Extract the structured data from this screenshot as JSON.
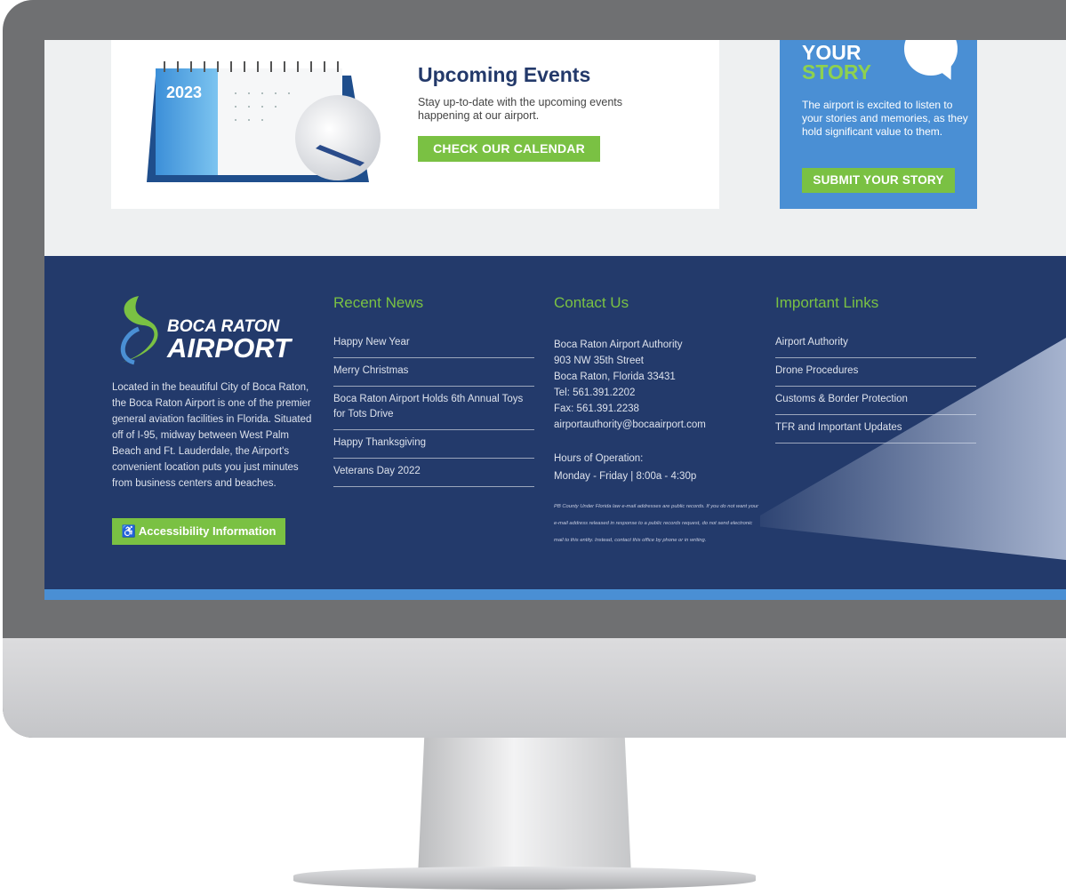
{
  "events": {
    "title": "Upcoming Events",
    "description": "Stay up-to-date with the upcoming events happening at our airport.",
    "button": "CHECK OUR CALENDAR",
    "calendar_year": "2023"
  },
  "story": {
    "title_line1": "YOUR",
    "title_line2": "STORY",
    "description": "The airport is excited to listen to your stories and memories, as they hold significant value to them.",
    "button": "SUBMIT YOUR STORY"
  },
  "footer": {
    "logo_line1": "BOCA RATON",
    "logo_line2": "AIRPORT",
    "about": "Located in the beautiful City of Boca Raton, the Boca Raton Airport is one of the premier general aviation facilities in Florida. Situated off of I-95, midway between West Palm Beach and Ft. Lauderdale, the Airport's convenient location puts you just minutes from business centers and beaches.",
    "accessibility_button": "Accessibility Information",
    "accessibility_icon": "wheelchair-icon",
    "news": {
      "heading": "Recent News",
      "items": [
        "Happy New Year",
        "Merry Christmas",
        "Boca Raton Airport Holds 6th Annual Toys for Tots Drive",
        "Happy Thanksgiving",
        "Veterans Day 2022"
      ]
    },
    "contact": {
      "heading": "Contact Us",
      "lines": [
        "Boca Raton Airport Authority",
        "903 NW 35th Street",
        "Boca Raton, Florida 33431",
        "Tel: 561.391.2202",
        "Fax: 561.391.2238",
        "airportauthority@bocaairport.com"
      ],
      "hours_label": "Hours of Operation:",
      "hours": "Monday - Friday | 8:00a - 4:30p",
      "disclaimer": "PB County Under Florida law e-mail addresses are public records. If you do not want your e-mail address released in response to a public records request, do not send electronic mail to this entity. Instead, contact this office by phone or in writing."
    },
    "links": {
      "heading": "Important Links",
      "items": [
        "Airport Authority",
        "Drone Procedures",
        "Customs & Border Protection",
        "TFR and Important Updates"
      ]
    }
  },
  "colors": {
    "navy": "#233a6b",
    "green": "#7ac143",
    "blue": "#4a8fd4"
  }
}
